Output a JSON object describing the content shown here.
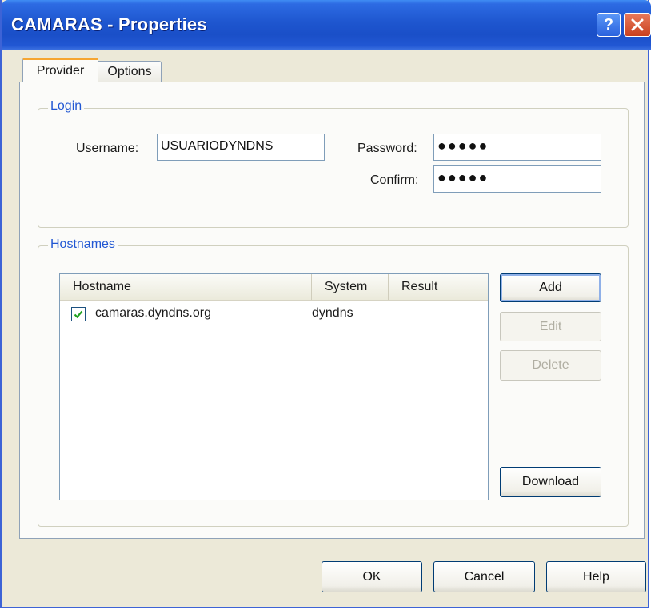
{
  "window": {
    "title": "CAMARAS - Properties",
    "help_glyph": "?",
    "close_glyph": "X"
  },
  "tabs": [
    {
      "label": "Provider",
      "selected": true
    },
    {
      "label": "Options",
      "selected": false
    }
  ],
  "login": {
    "group_label": "Login",
    "username_label": "Username:",
    "username_value": "USUARIODYNDNS",
    "password_label": "Password:",
    "password_masked": "●●●●●",
    "confirm_label": "Confirm:",
    "confirm_masked": "●●●●●"
  },
  "hostnames": {
    "group_label": "Hostnames",
    "columns": [
      "Hostname",
      "System",
      "Result"
    ],
    "rows": [
      {
        "checked": true,
        "hostname": "camaras.dyndns.org",
        "system": "dyndns",
        "result": ""
      }
    ],
    "buttons": {
      "add": "Add",
      "edit": "Edit",
      "delete": "Delete",
      "download": "Download"
    }
  },
  "footer": {
    "ok": "OK",
    "cancel": "Cancel",
    "help": "Help"
  },
  "colors": {
    "titlebar": "#1e56cf",
    "group_label": "#2157d3",
    "tab_highlight": "#f6a633",
    "close_button": "#c9401e"
  }
}
